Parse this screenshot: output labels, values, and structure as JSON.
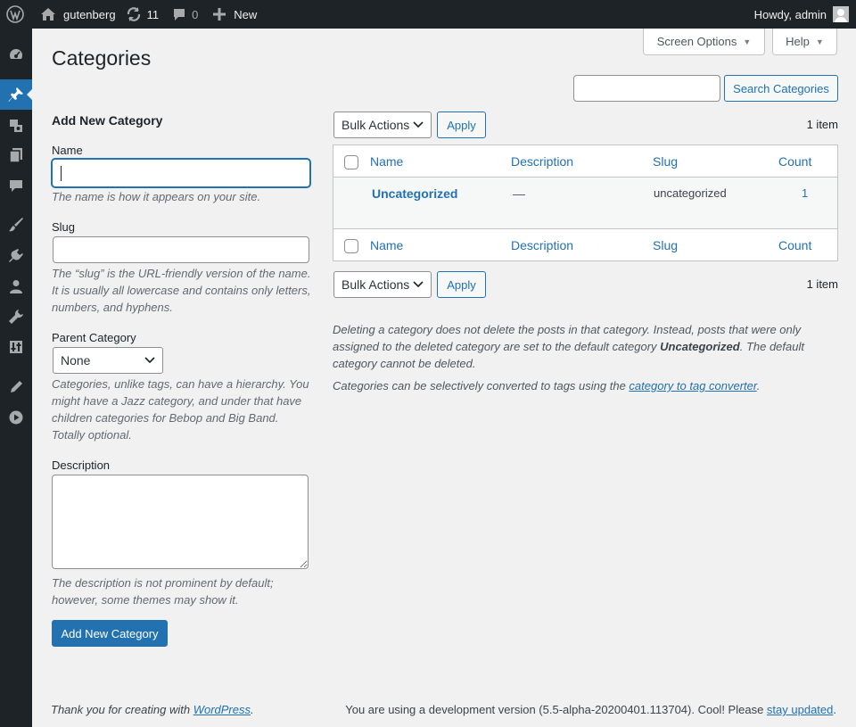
{
  "admin_bar": {
    "site_name": "gutenberg",
    "updates_count": "11",
    "comments_count": "0",
    "new_label": "New",
    "greeting": "Howdy, admin"
  },
  "screen_options": {
    "label": "Screen Options",
    "help_label": "Help"
  },
  "page": {
    "title": "Categories"
  },
  "search": {
    "button_label": "Search Categories",
    "value": ""
  },
  "form": {
    "heading": "Add New Category",
    "name_label": "Name",
    "name_value": "",
    "name_help": "The name is how it appears on your site.",
    "slug_label": "Slug",
    "slug_value": "",
    "slug_help": "The “slug” is the URL-friendly version of the name. It is usually all lowercase and contains only letters, numbers, and hyphens.",
    "parent_label": "Parent Category",
    "parent_selected": "None",
    "parent_help": "Categories, unlike tags, can have a hierarchy. You might have a Jazz category, and under that have children categories for Bebop and Big Band. Totally optional.",
    "description_label": "Description",
    "description_value": "",
    "description_help": "The description is not prominent by default; however, some themes may show it.",
    "submit_label": "Add New Category"
  },
  "bulk": {
    "selected": "Bulk Actions",
    "apply_label": "Apply",
    "item_count": "1 item"
  },
  "table": {
    "columns": {
      "name": "Name",
      "description": "Description",
      "slug": "Slug",
      "count": "Count"
    },
    "rows": [
      {
        "name": "Uncategorized",
        "description": "—",
        "slug": "uncategorized",
        "count": "1"
      }
    ]
  },
  "notes": {
    "delete_part1": "Deleting a category does not delete the posts in that category. Instead, posts that were only assigned to the deleted category are set to the default category ",
    "delete_bold": "Uncategorized",
    "delete_part2": ". The default category cannot be deleted.",
    "convert_part1": "Categories can be selectively converted to tags using the ",
    "convert_link": "category to tag converter",
    "convert_part2": "."
  },
  "footer": {
    "thanks_part1": "Thank you for creating with ",
    "thanks_link": "WordPress",
    "thanks_part2": ".",
    "version_part1": "You are using a development version (5.5-alpha-20200401.113704). Cool! Please ",
    "version_link": "stay updated",
    "version_part2": "."
  },
  "icons": {
    "admin_bar": [
      "wordpress-logo-icon",
      "home-icon",
      "updates-icon",
      "comment-icon",
      "plus-icon",
      "avatar"
    ],
    "sidebar": [
      "dashboard-icon",
      "pin-icon",
      "media-icon",
      "pages-icon",
      "comments-icon",
      "appearance-icon",
      "plugins-icon",
      "users-icon",
      "tools-icon",
      "settings-icon",
      "edit-icon",
      "play-icon"
    ]
  },
  "colors": {
    "accent": "#2271b1",
    "admin_bar": "#1d2327",
    "background": "#f1f1f1"
  }
}
